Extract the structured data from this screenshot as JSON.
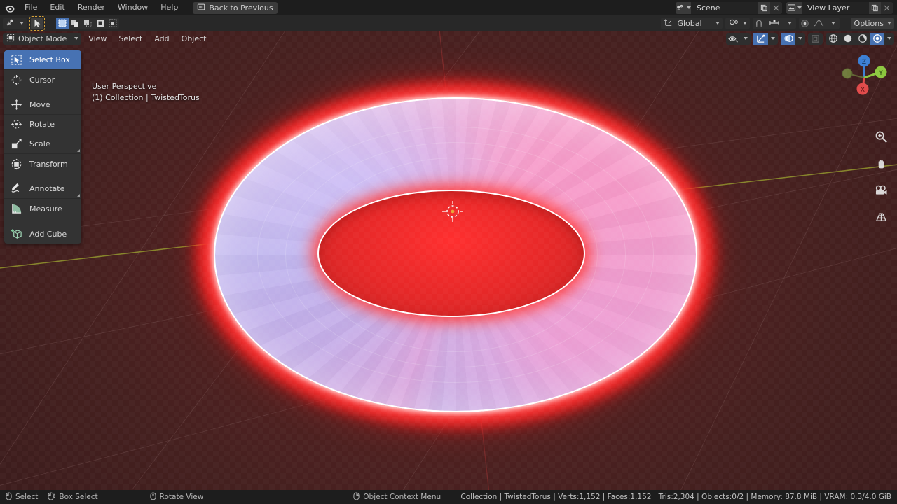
{
  "app": {
    "name": "Blender",
    "logo_icon": "blender-logo-icon"
  },
  "topbar": {
    "menus": [
      {
        "label": "File",
        "name": "menu-file"
      },
      {
        "label": "Edit",
        "name": "menu-edit"
      },
      {
        "label": "Render",
        "name": "menu-render"
      },
      {
        "label": "Window",
        "name": "menu-window"
      },
      {
        "label": "Help",
        "name": "menu-help"
      }
    ],
    "back_button": {
      "label": "Back to Previous",
      "icon": "back-to-previous-icon"
    },
    "scene": {
      "label": "Scene",
      "icon": "scene-icon",
      "new_icon": "new-scene-icon",
      "unlink_icon": "unlink-icon"
    },
    "view_layer": {
      "label": "View Layer",
      "icon": "view-layer-icon",
      "new_icon": "new-view-layer-icon",
      "unlink_icon": "unlink-icon"
    }
  },
  "tool_settings": {
    "editor_type": "editor-type-icon",
    "active_tool_icon": "cursor-arrow-icon",
    "select_modes": [
      {
        "name": "select-mode-set",
        "icon": "select-set-icon",
        "active": true
      },
      {
        "name": "select-mode-extend",
        "icon": "select-extend-icon",
        "active": false
      },
      {
        "name": "select-mode-subtract",
        "icon": "select-subtract-icon",
        "active": false
      },
      {
        "name": "select-mode-invert",
        "icon": "select-invert-icon",
        "active": false
      },
      {
        "name": "select-mode-intersect",
        "icon": "select-intersect-icon",
        "active": false
      }
    ],
    "transform_orientation": {
      "label": "Global",
      "icon": "orientation-icon"
    },
    "pivot_icon": "pivot-point-icon",
    "snap_icon": "snap-magnet-icon",
    "snap_to_icon": "snap-increment-icon",
    "proportional_icon": "proportional-editing-icon",
    "falloff_icon": "proportional-falloff-icon",
    "options_label": "Options"
  },
  "viewport_header": {
    "mode": {
      "label": "Object Mode",
      "icon": "object-mode-icon"
    },
    "menus": [
      {
        "label": "View",
        "name": "viewport-menu-view"
      },
      {
        "label": "Select",
        "name": "viewport-menu-select"
      },
      {
        "label": "Add",
        "name": "viewport-menu-add"
      },
      {
        "label": "Object",
        "name": "viewport-menu-object"
      }
    ],
    "visibility_icon": "object-visibility-icon",
    "gizmo_icon": "gizmo-icon",
    "overlays_icon": "overlays-icon",
    "xray_icon": "toggle-xray-icon",
    "shading": [
      {
        "name": "shading-wireframe",
        "icon": "wireframe-icon",
        "active": false
      },
      {
        "name": "shading-solid",
        "icon": "solid-icon",
        "active": false
      },
      {
        "name": "shading-material-preview",
        "icon": "material-preview-icon",
        "active": false
      },
      {
        "name": "shading-rendered",
        "icon": "rendered-icon",
        "active": true
      }
    ]
  },
  "viewport": {
    "perspective_label": "User Perspective",
    "collection_label": "(1) Collection | TwistedTorus",
    "object_name": "TwistedTorus",
    "colors": {
      "world_background": "#4a2020",
      "glow_red": "#ff2424",
      "torus_lavender": "#c3b0ec",
      "torus_pink": "#f79ac9",
      "rim_white": "#ffffff",
      "y_axis": "#8a8a2b",
      "x_axis": "#7a2a2a"
    },
    "nav_gizmo": {
      "axes": [
        {
          "label": "Z",
          "color": "#3b7fd4",
          "name": "gizmo-axis-z"
        },
        {
          "label": "Y",
          "color": "#8cc63e",
          "name": "gizmo-axis-y"
        },
        {
          "label": "X",
          "color": "#e04a4a",
          "name": "gizmo-axis-x"
        }
      ]
    },
    "nav_buttons": [
      {
        "name": "zoom-view-icon",
        "glyph": "zoom"
      },
      {
        "name": "move-view-icon",
        "glyph": "hand"
      },
      {
        "name": "camera-view-icon",
        "glyph": "camera"
      },
      {
        "name": "toggle-perspective-icon",
        "glyph": "grid"
      }
    ]
  },
  "toolbar": {
    "items": [
      {
        "label": "Select Box",
        "icon": "select-box-icon",
        "active": true,
        "group": 0,
        "expandable": false
      },
      {
        "label": "Cursor",
        "icon": "cursor-icon",
        "active": false,
        "group": 0,
        "expandable": false
      },
      {
        "label": "Move",
        "icon": "move-icon",
        "active": false,
        "group": 1,
        "expandable": false
      },
      {
        "label": "Rotate",
        "icon": "rotate-icon",
        "active": false,
        "group": 1,
        "expandable": false
      },
      {
        "label": "Scale",
        "icon": "scale-icon",
        "active": false,
        "group": 1,
        "expandable": true
      },
      {
        "label": "Transform",
        "icon": "transform-icon",
        "active": false,
        "group": 1,
        "expandable": false
      },
      {
        "label": "Annotate",
        "icon": "annotate-icon",
        "active": false,
        "group": 2,
        "expandable": true
      },
      {
        "label": "Measure",
        "icon": "measure-icon",
        "active": false,
        "group": 2,
        "expandable": false
      },
      {
        "label": "Add Cube",
        "icon": "add-cube-icon",
        "active": false,
        "group": 3,
        "expandable": false
      }
    ]
  },
  "statusbar": {
    "hints": [
      {
        "label": "Select",
        "icon": "mouse-left-icon"
      },
      {
        "label": "Box Select",
        "icon": "mouse-left-drag-icon"
      },
      {
        "label": "Rotate View",
        "icon": "mouse-middle-icon"
      },
      {
        "label": "Object Context Menu",
        "icon": "mouse-right-icon"
      }
    ],
    "stats": "Collection | TwistedTorus | Verts:1,152 | Faces:1,152 | Tris:2,304 | Objects:0/2 | Memory: 87.8 MiB | VRAM: 0.3/4.0 GiB"
  }
}
